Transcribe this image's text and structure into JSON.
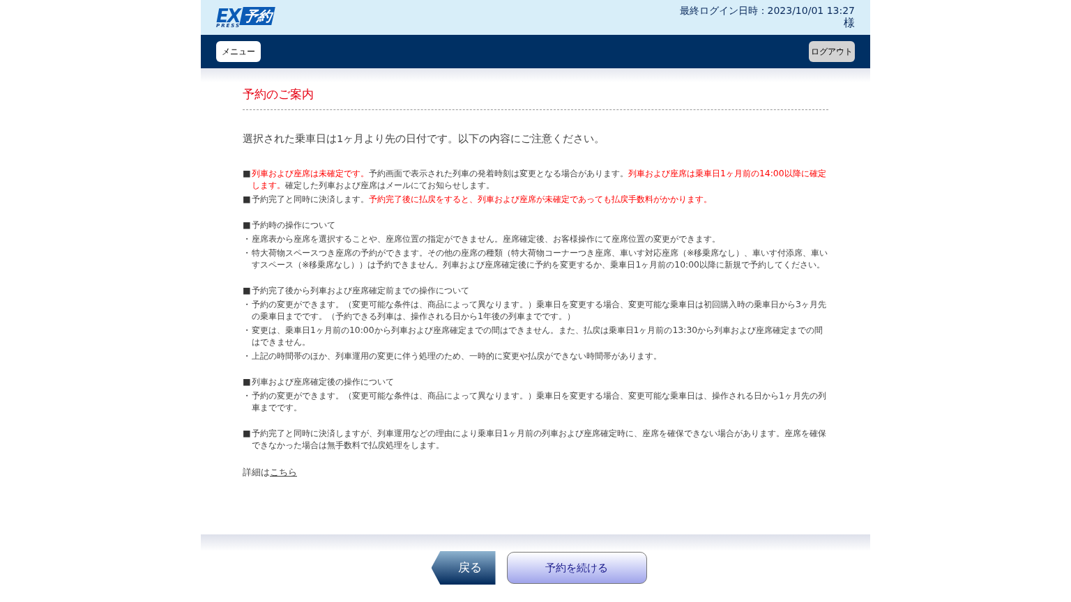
{
  "logo": {
    "ex": "EX",
    "press": "PRESS",
    "yoyaku": "予約"
  },
  "header": {
    "last_login": "最終ログイン日時：2023/10/01 13:27",
    "honorific": "様"
  },
  "nav": {
    "menu_button": "メニュー",
    "logout_button": "ログアウト"
  },
  "page_title": "予約のご案内",
  "intro": "選択された乗車日は1ヶ月より先の日付です。以下の内容にご注意ください。",
  "sections": [
    {
      "items": [
        {
          "marker": "■",
          "segments": [
            {
              "text": "列車および座席は未確定です。",
              "emphasis": true
            },
            {
              "text": "予約画面で表示された列車の発着時刻は変更となる場合があります。",
              "emphasis": false
            },
            {
              "text": "列車および座席は乗車日1ヶ月前の14:00以降に確定します。",
              "emphasis": true
            },
            {
              "text": "確定した列車および座席はメールにてお知らせします。",
              "emphasis": false
            }
          ]
        },
        {
          "marker": "■",
          "segments": [
            {
              "text": "予約完了と同時に決済します。",
              "emphasis": false
            },
            {
              "text": "予約完了後に払戻をすると、列車および座席が未確定であっても払戻手数料がかかります。",
              "emphasis": true
            }
          ]
        }
      ]
    },
    {
      "items": [
        {
          "marker": "■",
          "segments": [
            {
              "text": "予約時の操作について",
              "emphasis": false
            }
          ]
        },
        {
          "marker": "・",
          "segments": [
            {
              "text": "座席表から座席を選択することや、座席位置の指定ができません。座席確定後、お客様操作にて座席位置の変更ができます。",
              "emphasis": false
            }
          ]
        },
        {
          "marker": "・",
          "segments": [
            {
              "text": "特大荷物スペースつき座席の予約ができます。その他の座席の種類（特大荷物コーナーつき座席、車いす対応座席（※移乗席なし）、車いす付添席、車いすスペース（※移乗席なし））は予約できません。列車および座席確定後に予約を変更するか、乗車日1ヶ月前の10:00以降に新規で予約してください。",
              "emphasis": false
            }
          ]
        }
      ]
    },
    {
      "items": [
        {
          "marker": "■",
          "segments": [
            {
              "text": "予約完了後から列車および座席確定前までの操作について",
              "emphasis": false
            }
          ]
        },
        {
          "marker": "・",
          "segments": [
            {
              "text": "予約の変更ができます。（変更可能な条件は、商品によって異なります。）乗車日を変更する場合、変更可能な乗車日は初回購入時の乗車日から3ヶ月先の乗車日までです。（予約できる列車は、操作される日から1年後の列車までです。）",
              "emphasis": false
            }
          ]
        },
        {
          "marker": "・",
          "segments": [
            {
              "text": "変更は、乗車日1ヶ月前の10:00から列車および座席確定までの間はできません。また、払戻は乗車日1ヶ月前の13:30から列車および座席確定までの間はできません。",
              "emphasis": false
            }
          ]
        },
        {
          "marker": "・",
          "segments": [
            {
              "text": "上記の時間帯のほか、列車運用の変更に伴う処理のため、一時的に変更や払戻ができない時間帯があります。",
              "emphasis": false
            }
          ]
        }
      ]
    },
    {
      "items": [
        {
          "marker": "■",
          "segments": [
            {
              "text": "列車および座席確定後の操作について",
              "emphasis": false
            }
          ]
        },
        {
          "marker": "・",
          "segments": [
            {
              "text": "予約の変更ができます。（変更可能な条件は、商品によって異なります。）乗車日を変更する場合、変更可能な乗車日は、操作される日から1ヶ月先の列車までです。",
              "emphasis": false
            }
          ]
        }
      ]
    },
    {
      "items": [
        {
          "marker": "■",
          "segments": [
            {
              "text": "予約完了と同時に決済しますが、列車運用などの理由により乗車日1ヶ月前の列車および座席確定時に、座席を確保できない場合があります。座席を確保できなかった場合は無手数料で払戻処理をします。",
              "emphasis": false
            }
          ]
        }
      ]
    }
  ],
  "details": {
    "text": "詳細は",
    "link": "こちら"
  },
  "buttons": {
    "back": "戻る",
    "continue": "予約を続ける"
  }
}
